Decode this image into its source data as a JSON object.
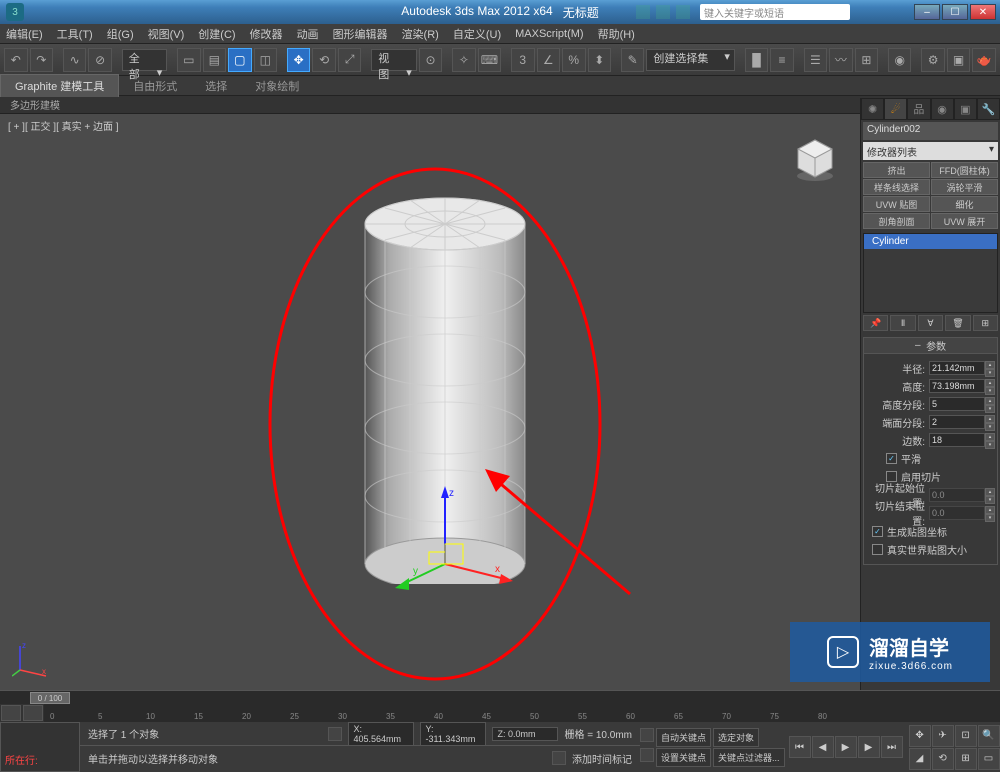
{
  "title": {
    "app": "Autodesk 3ds Max 2012 x64",
    "doc": "无标题",
    "search_ph": "键入关键字或短语"
  },
  "menu": [
    "编辑(E)",
    "工具(T)",
    "组(G)",
    "视图(V)",
    "创建(C)",
    "修改器",
    "动画",
    "图形编辑器",
    "渲染(R)",
    "自定义(U)",
    "MAXScript(M)",
    "帮助(H)"
  ],
  "toolbar": {
    "all": "全部",
    "view": "视图",
    "selset": "创建选择集"
  },
  "ribbon": {
    "tabs": [
      "Graphite 建模工具",
      "自由形式",
      "选择",
      "对象绘制"
    ],
    "sub": "多边形建模"
  },
  "viewport": {
    "label": "[ + ][ 正交 ][ 真实 + 边面 ]"
  },
  "cmdpanel": {
    "obj_name": "Cylinder002",
    "modlist": "修改器列表",
    "btns": [
      "挤出",
      "FFD(圆柱体)",
      "样条线选择",
      "涡轮平滑",
      "UVW 贴图",
      "细化",
      "剖角剖面",
      "UVW 展开"
    ],
    "stack_item": "Cylinder",
    "rollout_title": "参数",
    "params": {
      "radius_l": "半径:",
      "radius_v": "21.142mm",
      "height_l": "高度:",
      "height_v": "73.198mm",
      "hseg_l": "高度分段:",
      "hseg_v": "5",
      "cseg_l": "端面分段:",
      "cseg_v": "2",
      "sides_l": "边数:",
      "sides_v": "18",
      "smooth": "平滑",
      "slice_on": "启用切片",
      "slice_from_l": "切片起始位置:",
      "slice_from_v": "0.0",
      "slice_to_l": "切片结束位置:",
      "slice_to_v": "0.0",
      "genmap": "生成贴图坐标",
      "realworld": "真实世界贴图大小"
    }
  },
  "timeline": {
    "pos": "0 / 100",
    "ticks": [
      "0",
      "5",
      "10",
      "15",
      "20",
      "25",
      "30",
      "35",
      "40",
      "45",
      "50",
      "55",
      "60",
      "65",
      "70",
      "75",
      "80"
    ]
  },
  "status": {
    "loc_label": "所在行:",
    "sel_msg": "选择了 1 个对象",
    "hint": "单击并拖动以选择并移动对象",
    "add_time": "添加时间标记",
    "x": "X: 405.564mm",
    "y": "Y: -311.343mm",
    "z": "Z: 0.0mm",
    "grid": "栅格 = 10.0mm",
    "autokey": "自动关键点",
    "selset2": "选定对象",
    "setkey": "设置关键点",
    "keyfilter": "关键点过滤器..."
  },
  "watermark": {
    "big": "溜溜自学",
    "small": "zixue.3d66.com"
  }
}
